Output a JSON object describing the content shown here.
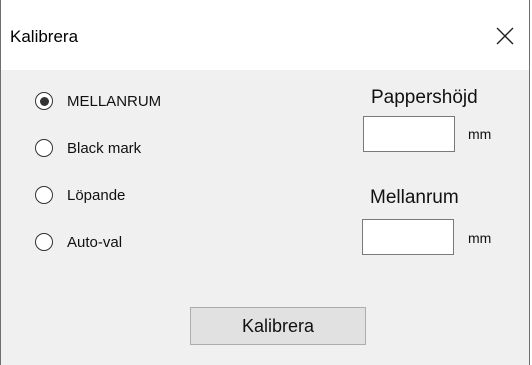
{
  "window": {
    "title": "Kalibrera",
    "close_icon": "close-icon"
  },
  "mode": {
    "options": [
      {
        "label": "MELLANRUM",
        "selected": true
      },
      {
        "label": "Black mark",
        "selected": false
      },
      {
        "label": "Löpande",
        "selected": false
      },
      {
        "label": "Auto-val",
        "selected": false
      }
    ]
  },
  "paper_height": {
    "label": "Pappershöjd",
    "value": "",
    "unit": "mm"
  },
  "gap": {
    "label": "Mellanrum",
    "value": "",
    "unit": "mm"
  },
  "calibrate_button": {
    "label": "Kalibrera"
  }
}
